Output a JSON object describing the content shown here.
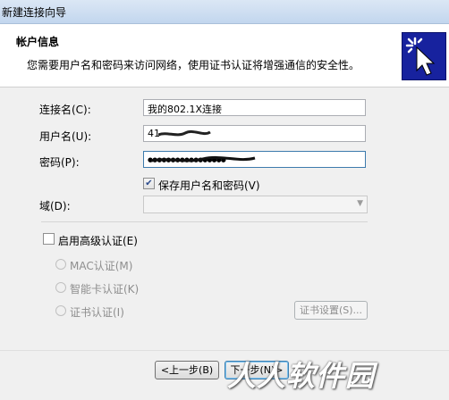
{
  "window": {
    "title": "新建连接向导"
  },
  "header": {
    "title": "帐户信息",
    "description": "您需要用户名和密码来访问网络，使用证书认证将增强通信的安全性。",
    "icon": "cursor-click-icon"
  },
  "form": {
    "connection_name_label": "连接名(C):",
    "connection_name_value": "我的802.1X连接",
    "username_label": "用户名(U):",
    "username_value": "41",
    "password_label": "密码(P):",
    "password_masked": "●●●●●●●●●●●●●●●●●",
    "save_credentials_label": "保存用户名和密码(V)",
    "save_credentials_checked": true,
    "domain_label": "域(D):",
    "domain_value": ""
  },
  "advanced": {
    "enable_label": "启用高级认证(E)",
    "enabled": false,
    "options": [
      {
        "label": "MAC认证(M)",
        "disabled": true
      },
      {
        "label": "智能卡认证(K)",
        "disabled": true
      },
      {
        "label": "证书认证(I)",
        "disabled": true
      }
    ],
    "cert_settings_label": "证书设置(S)..."
  },
  "footer": {
    "back_label": "<上一步(B)",
    "next_label": "下一步(N)>"
  },
  "watermark": "人人软件园",
  "colors": {
    "header_icon_bg": "#17229e",
    "title_bar": "#c2d6ee"
  }
}
